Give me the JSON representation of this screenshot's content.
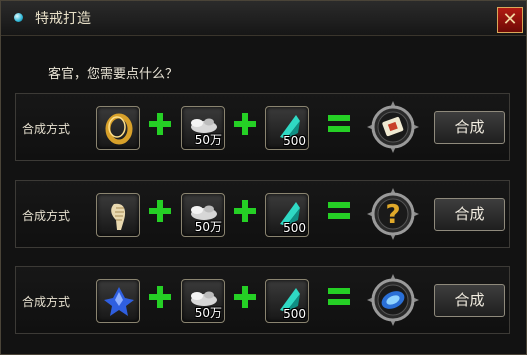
{
  "window": {
    "title": "特戒打造",
    "close_symbol": "✕"
  },
  "prompt": "客官，您需要点什么？",
  "recipes": [
    {
      "label": "合成方式",
      "ingredient_icon": "gold-ring-icon",
      "silver_qty": "50万",
      "gem_qty": "500",
      "result_icon": "scroll-icon",
      "result_text": "",
      "button": "合成"
    },
    {
      "label": "合成方式",
      "ingredient_icon": "bone-feather-icon",
      "silver_qty": "50万",
      "gem_qty": "500",
      "result_icon": "question-mark-icon",
      "result_text": "?",
      "button": "合成"
    },
    {
      "label": "合成方式",
      "ingredient_icon": "blue-crystal-icon",
      "silver_qty": "50万",
      "gem_qty": "500",
      "result_icon": "blue-orb-icon",
      "result_text": "",
      "button": "合成"
    }
  ],
  "colors": {
    "plus_equals": "#25d025",
    "accent_gold": "#d9a85a",
    "close_red": "#b21a12"
  }
}
